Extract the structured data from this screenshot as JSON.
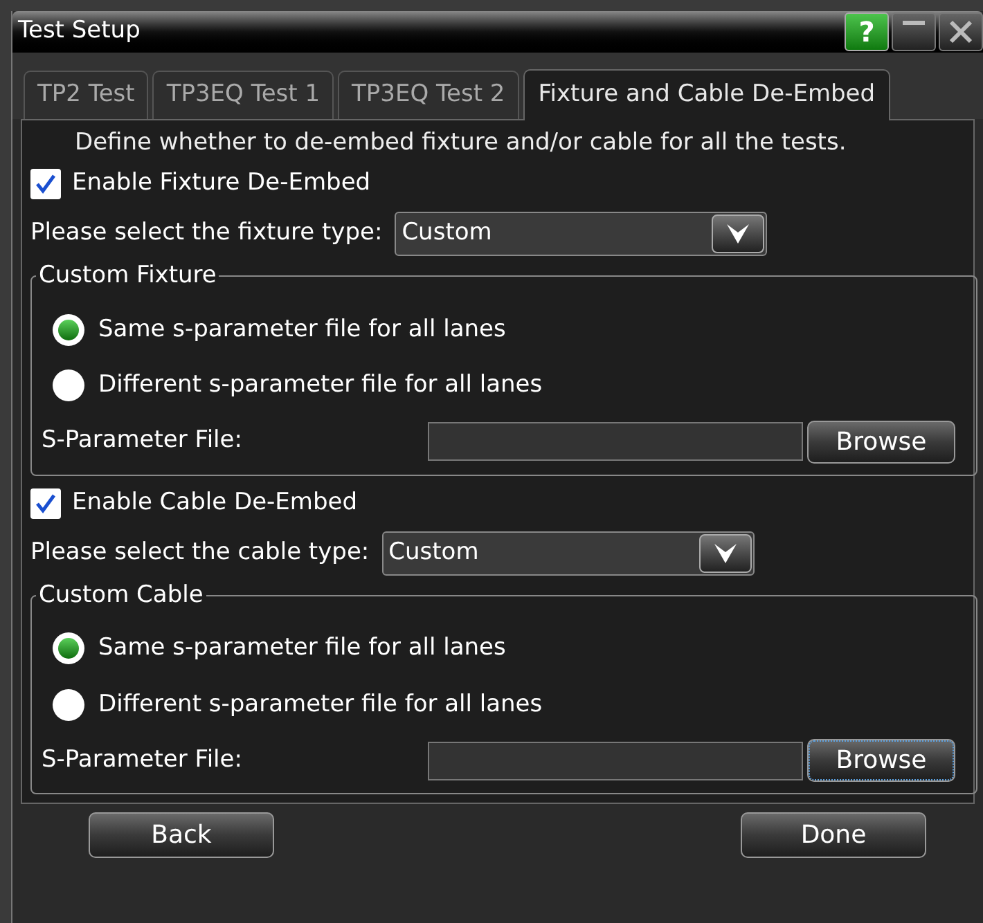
{
  "window": {
    "title": "Test Setup",
    "buttons": [
      {
        "kind": "help",
        "label": "?"
      },
      {
        "kind": "minimize"
      },
      {
        "kind": "close"
      }
    ]
  },
  "tabs": [
    {
      "label": "TP2 Test",
      "selected": false
    },
    {
      "label": "TP3EQ Test 1",
      "selected": false
    },
    {
      "label": "TP3EQ Test 2",
      "selected": false
    },
    {
      "label": "Fixture and Cable De-Embed",
      "selected": true
    }
  ],
  "description": "Define whether to de-embed fixture and/or cable for all the tests.",
  "sections": [
    {
      "enable": {
        "label": "Enable Fixture De-Embed",
        "checked": true
      },
      "select_label": "Please select the fixture type:",
      "select_value": "Custom",
      "group_title": "Custom Fixture",
      "options": [
        {
          "label": "Same s-parameter file for all lanes",
          "selected": true
        },
        {
          "label": "Different s-parameter file for all lanes",
          "selected": false
        }
      ],
      "file_label": "S-Parameter File:",
      "browse": {
        "label": "Browse",
        "focused": false
      }
    },
    {
      "enable": {
        "label": "Enable Cable De-Embed",
        "checked": true
      },
      "select_label": "Please select the cable type:",
      "select_value": "Custom",
      "group_title": "Custom Cable",
      "options": [
        {
          "label": "Same s-parameter file for all lanes",
          "selected": true
        },
        {
          "label": "Different s-parameter file for all lanes",
          "selected": false
        }
      ],
      "file_label": "S-Parameter File:",
      "browse": {
        "label": "Browse",
        "focused": true
      }
    }
  ],
  "footer": [
    {
      "label": "Back"
    },
    {
      "label": "Done"
    }
  ]
}
